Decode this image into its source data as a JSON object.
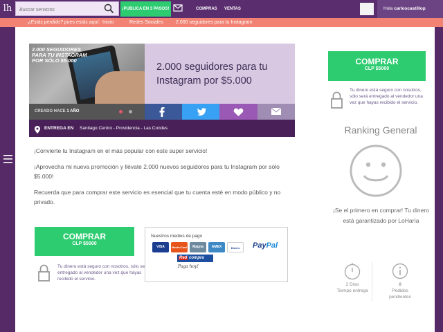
{
  "topbar": {
    "logo": "lh",
    "search_placeholder": "Buscar servicios",
    "publica": "¡PUBLICA EN 3 PASOS!",
    "compras": "COMPRAS",
    "ventas": "VENTAS",
    "hola_prefix": "Hola",
    "username": "carloscastillop"
  },
  "breadcrumb": {
    "lost": "¿Estás perdido? pues estás aquí:",
    "items": [
      "Inicio",
      "Redes Sociales",
      "2.000 seguidores para tu Instagram"
    ]
  },
  "hero": {
    "promo_text": "2.000 SEGUIDORES PARA TU INSTAGRAM POR SÓLO $5.000",
    "title": "2.000 seguidores para tu Instagram por $5.000",
    "creado_label": "CREADO HACE",
    "creado_value": "1 AÑO",
    "entrega_label": "ENTREGA EN",
    "entrega_value": "Santiago Centro - Providencia - Las Condes"
  },
  "description": {
    "p1": "¡Convierte tu Instagram en el más popular con este super servicio!",
    "p2": "¡Aprovecha mi nueva promoción y llévate 2.000 nuevos seguidores para tu Instagram por sólo $5.000!",
    "p3": "Recuerda que para comprar este servicio es esencial que tu cuenta esté en modo público y no privado."
  },
  "buy": {
    "label": "COMPRAR",
    "price": "CLP $5000",
    "secure_text": "Tu dinero está seguro con nosotros, sólo será entregado al vendedor una vez que hayas recibido el servicio."
  },
  "payment": {
    "title": "Nuestros medios de pago",
    "cards": [
      "VISA",
      "MasterCard",
      "Magna",
      "AMEX",
      "Diners"
    ],
    "paypal_a": "Pay",
    "paypal_b": "Pal",
    "redcompra_a": "Red",
    "redcompra_b": "compra",
    "pagahoy": "Paga hoy!"
  },
  "sidebar": {
    "ranking_title": "Ranking General",
    "first_buyer": "¡Se el primero en comprar! Tu dinero está garantizado por LoHaría",
    "stats": [
      {
        "value": "2 Días",
        "label": "Tiempo entrega"
      },
      {
        "value": "0",
        "label": "Pedidos pendientes"
      }
    ]
  },
  "colors": {
    "purple_dark": "#562a66",
    "green": "#2ecc71",
    "salmon": "#f28374",
    "facebook": "#3b5998",
    "twitter": "#38a1f3",
    "heart": "#9b59b6",
    "mail": "#9f8db3"
  }
}
